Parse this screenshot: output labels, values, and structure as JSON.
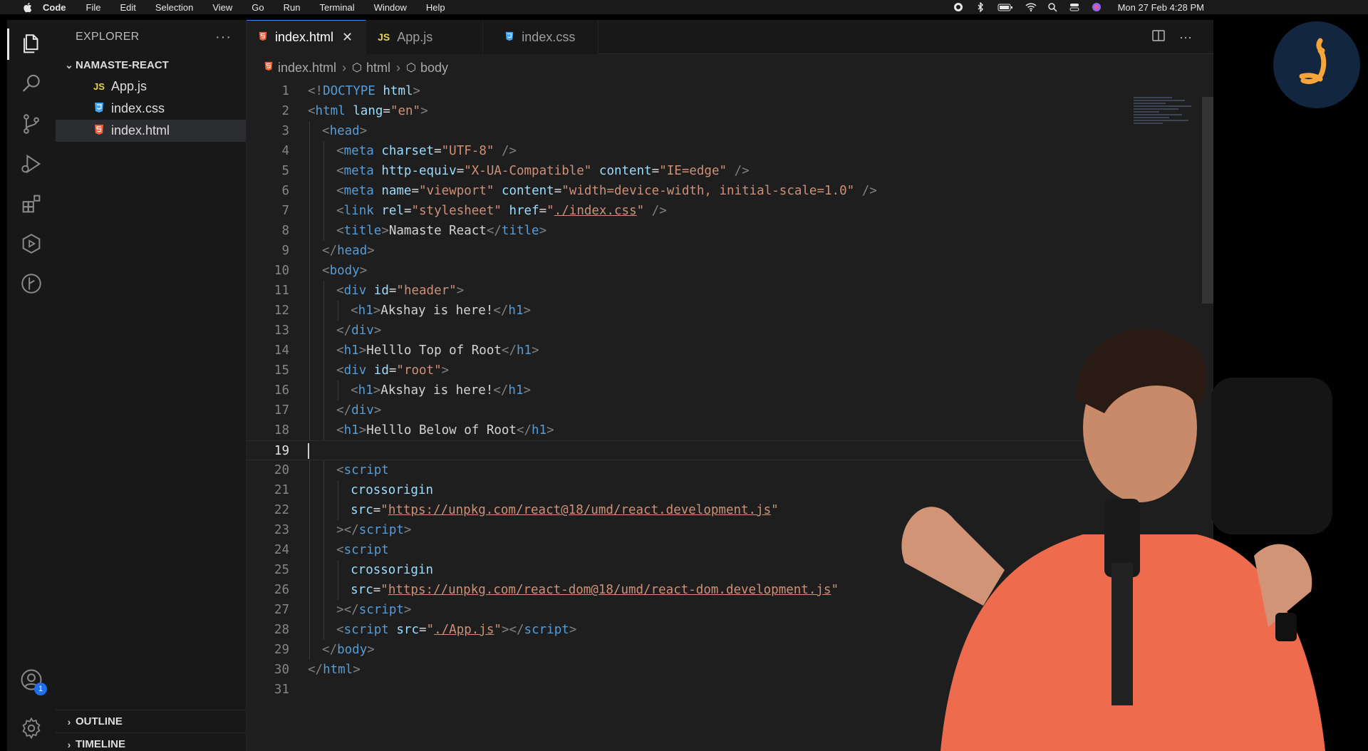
{
  "menubar": {
    "app": "Code",
    "items": [
      "File",
      "Edit",
      "Selection",
      "View",
      "Go",
      "Run",
      "Terminal",
      "Window",
      "Help"
    ],
    "clock": "Mon 27 Feb  4:28 PM"
  },
  "sidebar": {
    "title": "EXPLORER",
    "more": "···",
    "folder": "NAMASTE-REACT",
    "files": [
      {
        "label": "App.js",
        "icon": "JS"
      },
      {
        "label": "index.css",
        "icon": "css-file-icon"
      },
      {
        "label": "index.html",
        "icon": "html-file-icon"
      }
    ],
    "outline": "OUTLINE",
    "timeline": "TIMELINE"
  },
  "activity": {
    "accounts_badge": "1"
  },
  "tabs": [
    {
      "label": "index.html",
      "icon": "html-file-icon"
    },
    {
      "label": "App.js",
      "icon": "JS"
    },
    {
      "label": "index.css",
      "icon": "css-file-icon"
    }
  ],
  "breadcrumb": [
    "index.html",
    "html",
    "body"
  ],
  "colors": {
    "tag": "#569cd6",
    "attr": "#9cdcfe",
    "string": "#ce9178",
    "accent": "#3b82f6",
    "html_icon": "#f0613d",
    "css_icon": "#42a5f5",
    "js_icon": "#e8d44d"
  },
  "editor": {
    "cursor_line": 19,
    "lines": [
      {
        "n": "1",
        "indent": 0,
        "parts": [
          [
            "b",
            "<!"
          ],
          [
            "t",
            "DOCTYPE"
          ],
          [
            "x",
            " "
          ],
          [
            "a",
            "html"
          ],
          [
            "b",
            ">"
          ]
        ]
      },
      {
        "n": "2",
        "indent": 0,
        "parts": [
          [
            "b",
            "<"
          ],
          [
            "t",
            "html"
          ],
          [
            "x",
            " "
          ],
          [
            "a",
            "lang"
          ],
          [
            "x",
            "="
          ],
          [
            "s",
            "\"en\""
          ],
          [
            "b",
            ">"
          ]
        ]
      },
      {
        "n": "3",
        "indent": 1,
        "parts": [
          [
            "b",
            "<"
          ],
          [
            "t",
            "head"
          ],
          [
            "b",
            ">"
          ]
        ]
      },
      {
        "n": "4",
        "indent": 2,
        "parts": [
          [
            "b",
            "<"
          ],
          [
            "t",
            "meta"
          ],
          [
            "x",
            " "
          ],
          [
            "a",
            "charset"
          ],
          [
            "x",
            "="
          ],
          [
            "s",
            "\"UTF-8\""
          ],
          [
            "x",
            " "
          ],
          [
            "b",
            "/>"
          ]
        ]
      },
      {
        "n": "5",
        "indent": 2,
        "parts": [
          [
            "b",
            "<"
          ],
          [
            "t",
            "meta"
          ],
          [
            "x",
            " "
          ],
          [
            "a",
            "http-equiv"
          ],
          [
            "x",
            "="
          ],
          [
            "s",
            "\"X-UA-Compatible\""
          ],
          [
            "x",
            " "
          ],
          [
            "a",
            "content"
          ],
          [
            "x",
            "="
          ],
          [
            "s",
            "\"IE=edge\""
          ],
          [
            "x",
            " "
          ],
          [
            "b",
            "/>"
          ]
        ]
      },
      {
        "n": "6",
        "indent": 2,
        "parts": [
          [
            "b",
            "<"
          ],
          [
            "t",
            "meta"
          ],
          [
            "x",
            " "
          ],
          [
            "a",
            "name"
          ],
          [
            "x",
            "="
          ],
          [
            "s",
            "\"viewport\""
          ],
          [
            "x",
            " "
          ],
          [
            "a",
            "content"
          ],
          [
            "x",
            "="
          ],
          [
            "s",
            "\"width=device-width, initial-scale=1.0\""
          ],
          [
            "x",
            " "
          ],
          [
            "b",
            "/>"
          ]
        ]
      },
      {
        "n": "7",
        "indent": 2,
        "parts": [
          [
            "b",
            "<"
          ],
          [
            "t",
            "link"
          ],
          [
            "x",
            " "
          ],
          [
            "a",
            "rel"
          ],
          [
            "x",
            "="
          ],
          [
            "s",
            "\"stylesheet\""
          ],
          [
            "x",
            " "
          ],
          [
            "a",
            "href"
          ],
          [
            "x",
            "="
          ],
          [
            "s",
            "\""
          ],
          [
            "u",
            "./index.css"
          ],
          [
            "s",
            "\""
          ],
          [
            "x",
            " "
          ],
          [
            "b",
            "/>"
          ]
        ]
      },
      {
        "n": "8",
        "indent": 2,
        "parts": [
          [
            "b",
            "<"
          ],
          [
            "t",
            "title"
          ],
          [
            "b",
            ">"
          ],
          [
            "x",
            "Namaste React"
          ],
          [
            "b",
            "</"
          ],
          [
            "t",
            "title"
          ],
          [
            "b",
            ">"
          ]
        ]
      },
      {
        "n": "9",
        "indent": 1,
        "parts": [
          [
            "b",
            "</"
          ],
          [
            "t",
            "head"
          ],
          [
            "b",
            ">"
          ]
        ]
      },
      {
        "n": "10",
        "indent": 1,
        "parts": [
          [
            "b",
            "<"
          ],
          [
            "t",
            "body"
          ],
          [
            "b",
            ">"
          ]
        ]
      },
      {
        "n": "11",
        "indent": 2,
        "parts": [
          [
            "b",
            "<"
          ],
          [
            "t",
            "div"
          ],
          [
            "x",
            " "
          ],
          [
            "a",
            "id"
          ],
          [
            "x",
            "="
          ],
          [
            "s",
            "\"header\""
          ],
          [
            "b",
            ">"
          ]
        ]
      },
      {
        "n": "12",
        "indent": 3,
        "parts": [
          [
            "b",
            "<"
          ],
          [
            "t",
            "h1"
          ],
          [
            "b",
            ">"
          ],
          [
            "x",
            "Akshay is here!"
          ],
          [
            "b",
            "</"
          ],
          [
            "t",
            "h1"
          ],
          [
            "b",
            ">"
          ]
        ]
      },
      {
        "n": "13",
        "indent": 2,
        "parts": [
          [
            "b",
            "</"
          ],
          [
            "t",
            "div"
          ],
          [
            "b",
            ">"
          ]
        ]
      },
      {
        "n": "14",
        "indent": 2,
        "parts": [
          [
            "b",
            "<"
          ],
          [
            "t",
            "h1"
          ],
          [
            "b",
            ">"
          ],
          [
            "x",
            "Helllo Top of Root"
          ],
          [
            "b",
            "</"
          ],
          [
            "t",
            "h1"
          ],
          [
            "b",
            ">"
          ]
        ]
      },
      {
        "n": "15",
        "indent": 2,
        "parts": [
          [
            "b",
            "<"
          ],
          [
            "t",
            "div"
          ],
          [
            "x",
            " "
          ],
          [
            "a",
            "id"
          ],
          [
            "x",
            "="
          ],
          [
            "s",
            "\"root\""
          ],
          [
            "b",
            ">"
          ]
        ]
      },
      {
        "n": "16",
        "indent": 3,
        "parts": [
          [
            "b",
            "<"
          ],
          [
            "t",
            "h1"
          ],
          [
            "b",
            ">"
          ],
          [
            "x",
            "Akshay is here!"
          ],
          [
            "b",
            "</"
          ],
          [
            "t",
            "h1"
          ],
          [
            "b",
            ">"
          ]
        ]
      },
      {
        "n": "17",
        "indent": 2,
        "parts": [
          [
            "b",
            "</"
          ],
          [
            "t",
            "div"
          ],
          [
            "b",
            ">"
          ]
        ]
      },
      {
        "n": "18",
        "indent": 2,
        "parts": [
          [
            "b",
            "<"
          ],
          [
            "t",
            "h1"
          ],
          [
            "b",
            ">"
          ],
          [
            "x",
            "Helllo Below of Root"
          ],
          [
            "b",
            "</"
          ],
          [
            "t",
            "h1"
          ],
          [
            "b",
            ">"
          ]
        ]
      },
      {
        "n": "19",
        "indent": 0,
        "parts": []
      },
      {
        "n": "20",
        "indent": 2,
        "parts": [
          [
            "b",
            "<"
          ],
          [
            "t",
            "script"
          ]
        ]
      },
      {
        "n": "21",
        "indent": 3,
        "parts": [
          [
            "a",
            "crossorigin"
          ]
        ]
      },
      {
        "n": "22",
        "indent": 3,
        "parts": [
          [
            "a",
            "src"
          ],
          [
            "x",
            "="
          ],
          [
            "s",
            "\""
          ],
          [
            "u",
            "https://unpkg.com/react@18/umd/react.development.js"
          ],
          [
            "s",
            "\""
          ]
        ]
      },
      {
        "n": "23",
        "indent": 2,
        "parts": [
          [
            "b",
            "></"
          ],
          [
            "t",
            "script"
          ],
          [
            "b",
            ">"
          ]
        ]
      },
      {
        "n": "24",
        "indent": 2,
        "parts": [
          [
            "b",
            "<"
          ],
          [
            "t",
            "script"
          ]
        ]
      },
      {
        "n": "25",
        "indent": 3,
        "parts": [
          [
            "a",
            "crossorigin"
          ]
        ]
      },
      {
        "n": "26",
        "indent": 3,
        "parts": [
          [
            "a",
            "src"
          ],
          [
            "x",
            "="
          ],
          [
            "s",
            "\""
          ],
          [
            "u",
            "https://unpkg.com/react-dom@18/umd/react-dom.development.js"
          ],
          [
            "s",
            "\""
          ]
        ]
      },
      {
        "n": "27",
        "indent": 2,
        "parts": [
          [
            "b",
            "></"
          ],
          [
            "t",
            "script"
          ],
          [
            "b",
            ">"
          ]
        ]
      },
      {
        "n": "28",
        "indent": 2,
        "parts": [
          [
            "b",
            "<"
          ],
          [
            "t",
            "script"
          ],
          [
            "x",
            " "
          ],
          [
            "a",
            "src"
          ],
          [
            "x",
            "="
          ],
          [
            "s",
            "\""
          ],
          [
            "u",
            "./App.js"
          ],
          [
            "s",
            "\""
          ],
          [
            "b",
            "></"
          ],
          [
            "t",
            "script"
          ],
          [
            "b",
            ">"
          ]
        ]
      },
      {
        "n": "29",
        "indent": 1,
        "parts": [
          [
            "b",
            "</"
          ],
          [
            "t",
            "body"
          ],
          [
            "b",
            ">"
          ]
        ]
      },
      {
        "n": "30",
        "indent": 0,
        "parts": [
          [
            "b",
            "</"
          ],
          [
            "t",
            "html"
          ],
          [
            "b",
            ">"
          ]
        ]
      },
      {
        "n": "31",
        "indent": 0,
        "parts": []
      }
    ]
  }
}
